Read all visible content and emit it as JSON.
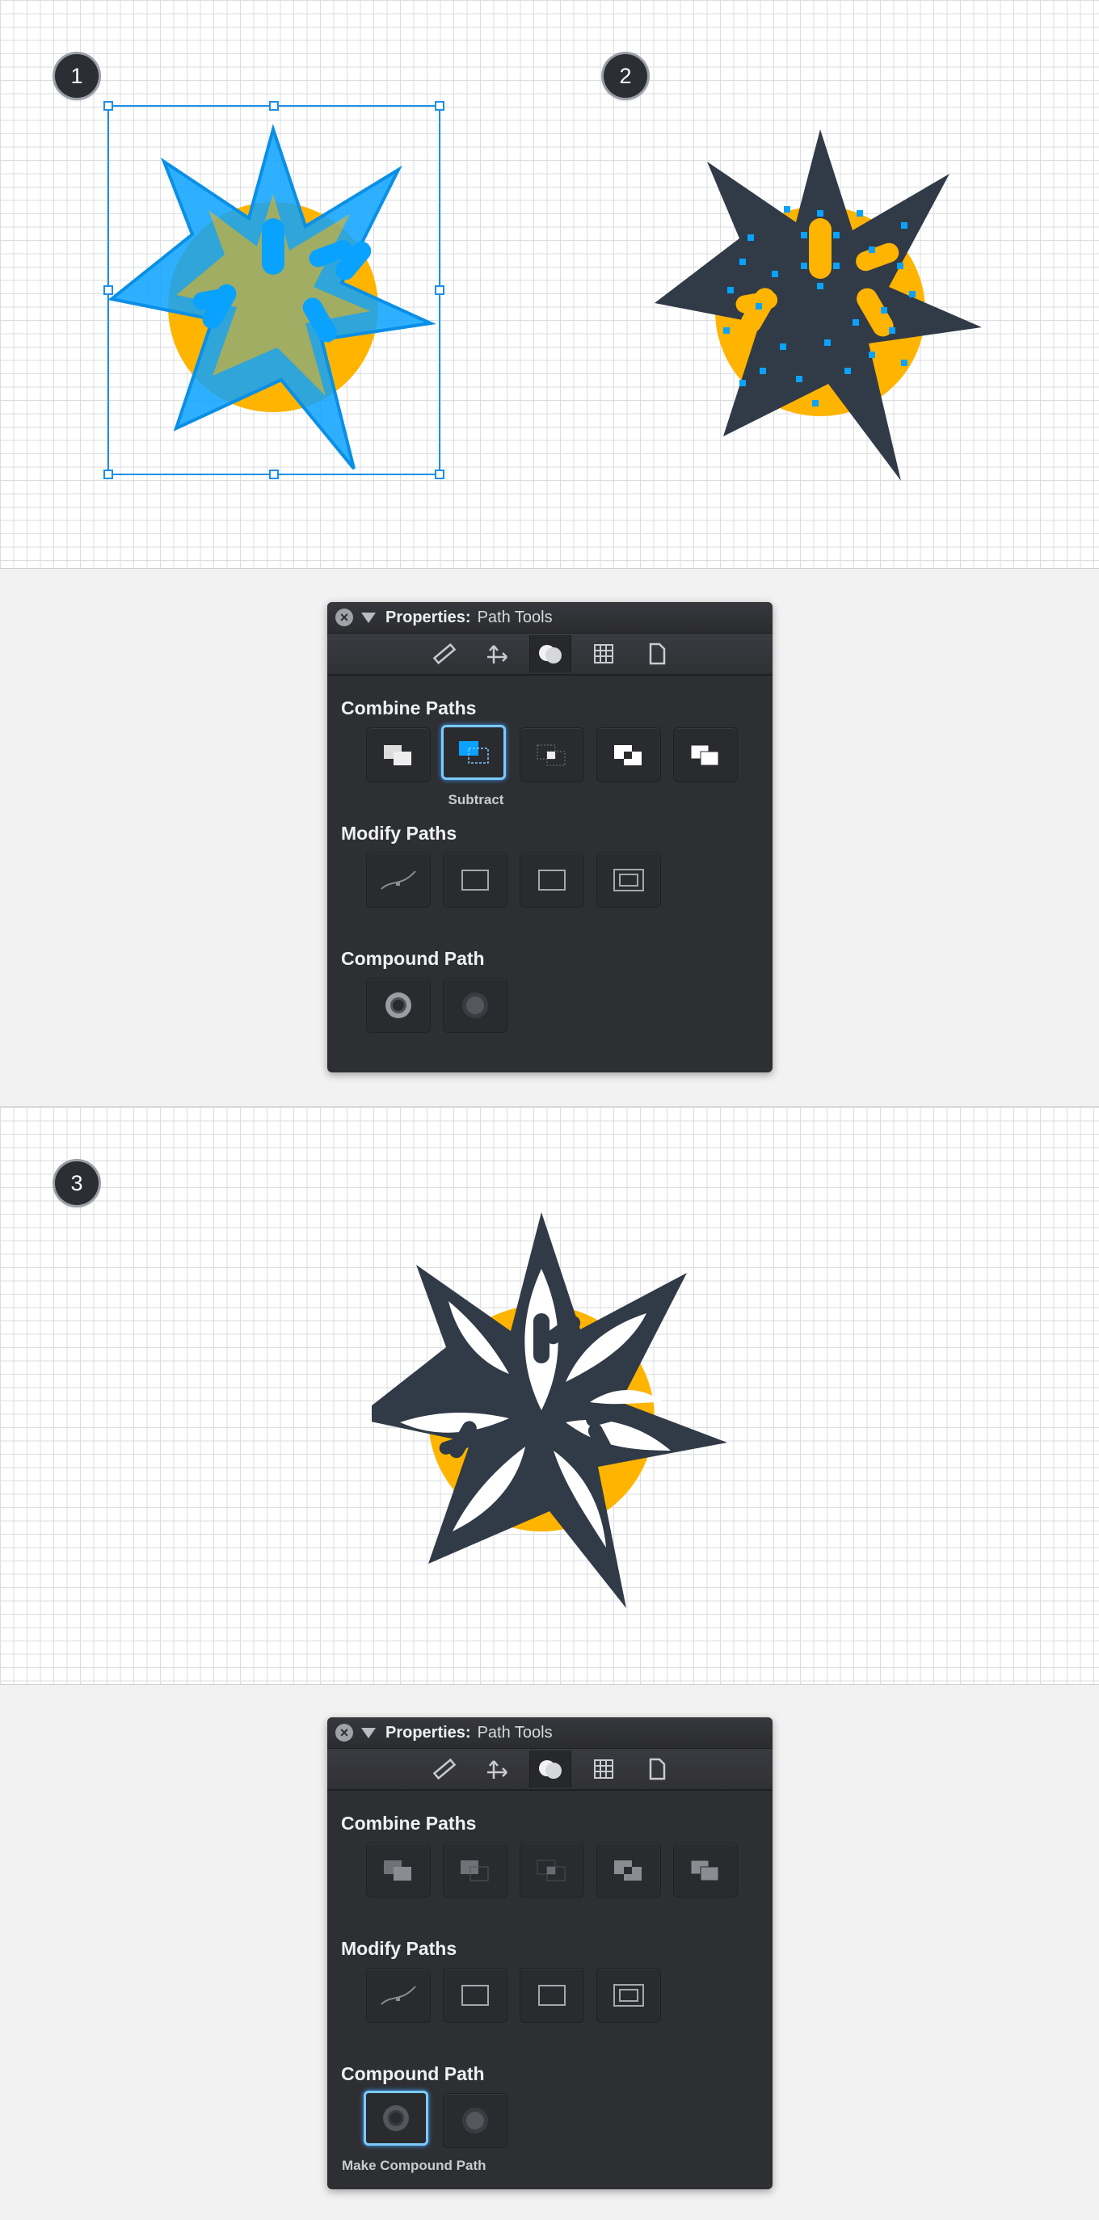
{
  "steps": {
    "one": "1",
    "two": "2",
    "three": "3"
  },
  "panel_top": {
    "title_label": "Properties:",
    "title_value": "Path Tools",
    "tabs": [
      "ruler-icon",
      "transform-icon",
      "path-ops-icon",
      "grid-icon",
      "document-icon"
    ],
    "sections": {
      "combine": "Combine Paths",
      "modify": "Modify Paths",
      "compound": "Compound Path"
    },
    "hover_caption": "Subtract"
  },
  "panel_bottom": {
    "title_label": "Properties:",
    "title_value": "Path Tools",
    "tabs": [
      "ruler-icon",
      "transform-icon",
      "path-ops-icon",
      "grid-icon",
      "document-icon"
    ],
    "sections": {
      "combine": "Combine Paths",
      "modify": "Modify Paths",
      "compound": "Compound Path"
    },
    "hover_caption": "Make Compound Path"
  },
  "colors": {
    "selection": "#0aa2ff",
    "star": "#313a47",
    "circle": "#ffb400",
    "panel": "#2e2f33"
  }
}
